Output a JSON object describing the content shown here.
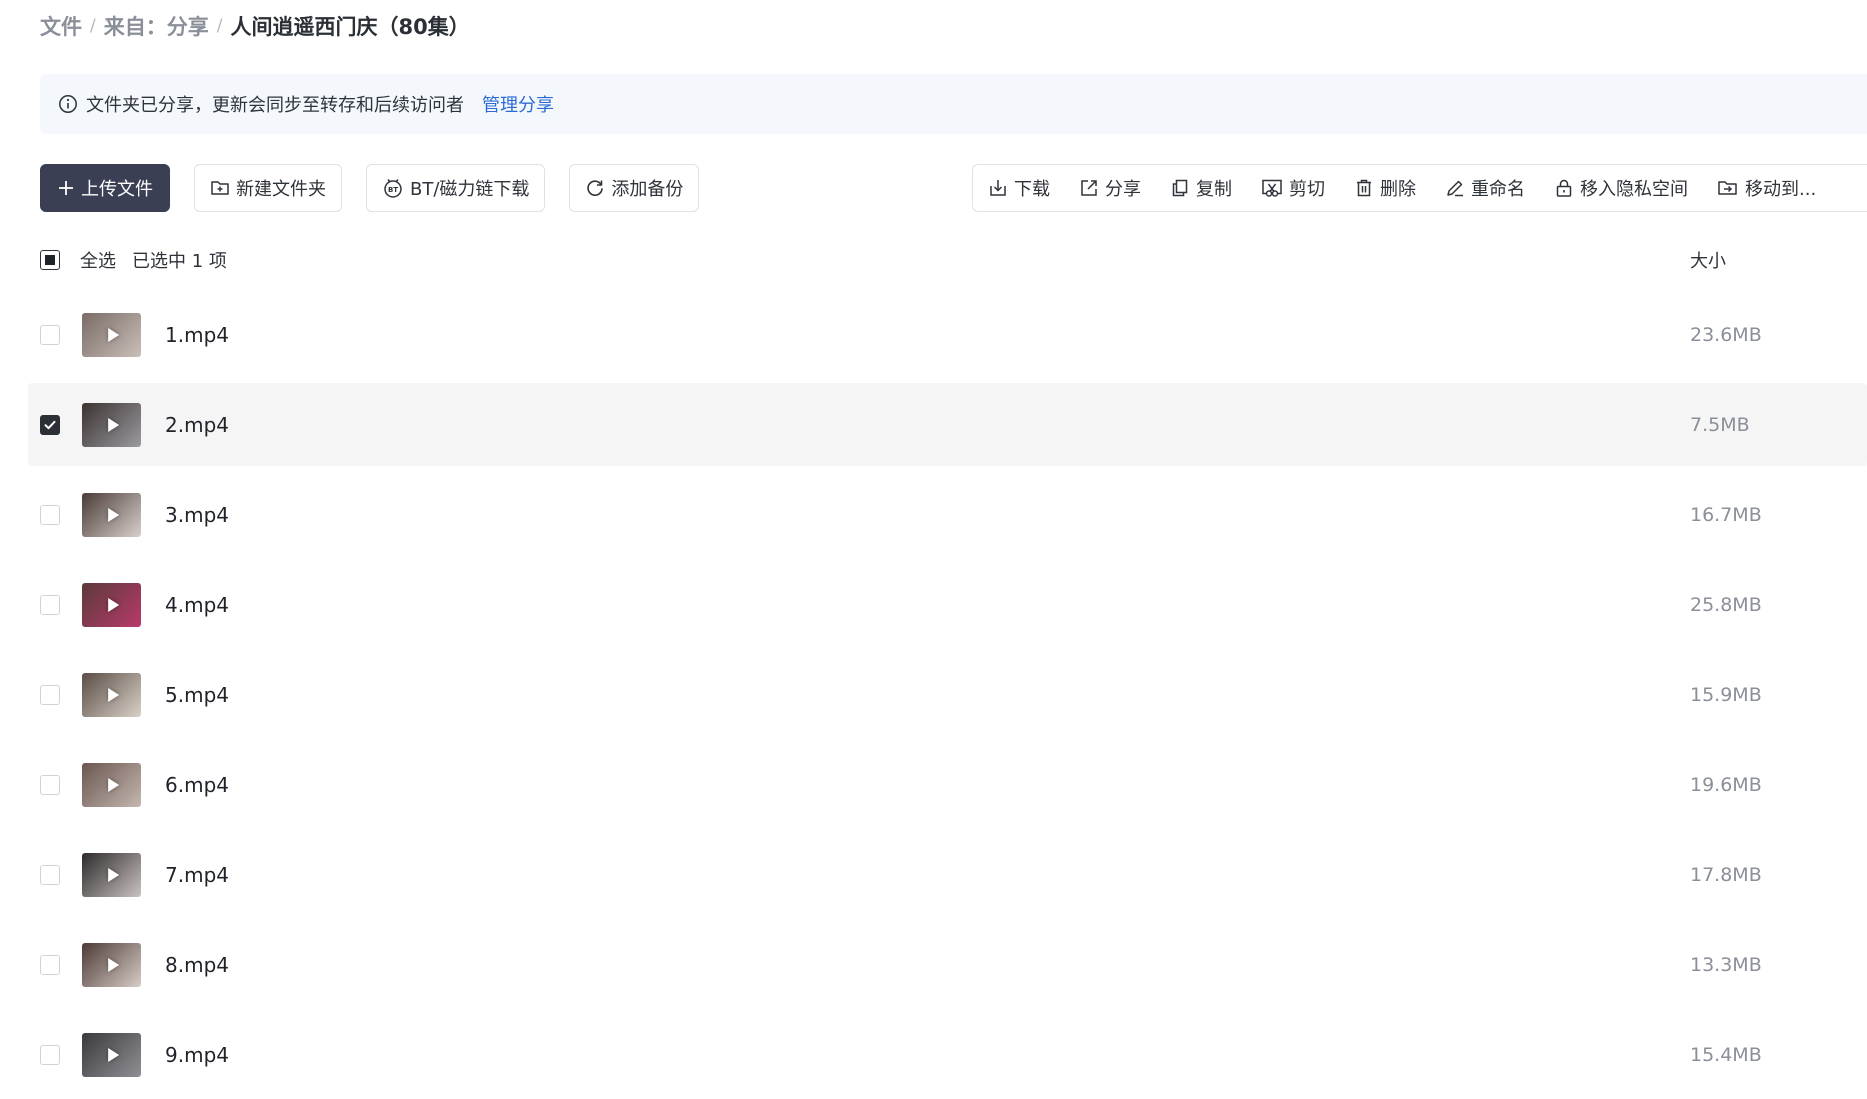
{
  "breadcrumb": {
    "root": "文件",
    "middle": "来自：分享",
    "current": "人间逍遥西门庆（80集）"
  },
  "notice": {
    "text": "文件夹已分享，更新会同步至转存和后续访问者",
    "link": "管理分享"
  },
  "toolbar": {
    "upload": "上传文件",
    "new_folder": "新建文件夹",
    "bt_download": "BT/磁力链下载",
    "add_backup": "添加备份"
  },
  "actions": {
    "download": "下载",
    "share": "分享",
    "copy": "复制",
    "cut": "剪切",
    "delete": "删除",
    "rename": "重命名",
    "private": "移入隐私空间",
    "move": "移动到..."
  },
  "list_header": {
    "select_all": "全选",
    "selected_count": "已选中 1 项",
    "size_column": "大小"
  },
  "files": [
    {
      "name": "1.mp4",
      "size": "23.6MB",
      "selected": false,
      "thumb_colors": [
        "#7a6b66",
        "#c9bfb8"
      ]
    },
    {
      "name": "2.mp4",
      "size": "7.5MB",
      "selected": true,
      "thumb_colors": [
        "#3b3331",
        "#9b9aa0"
      ]
    },
    {
      "name": "3.mp4",
      "size": "16.7MB",
      "selected": false,
      "thumb_colors": [
        "#4a3c38",
        "#d8d0cc"
      ]
    },
    {
      "name": "4.mp4",
      "size": "25.8MB",
      "selected": false,
      "thumb_colors": [
        "#5b3a3a",
        "#b83a6b"
      ]
    },
    {
      "name": "5.mp4",
      "size": "15.9MB",
      "selected": false,
      "thumb_colors": [
        "#5a4e46",
        "#d9d1c8"
      ]
    },
    {
      "name": "6.mp4",
      "size": "19.6MB",
      "selected": false,
      "thumb_colors": [
        "#6a5650",
        "#c4b8b0"
      ]
    },
    {
      "name": "7.mp4",
      "size": "17.8MB",
      "selected": false,
      "thumb_colors": [
        "#2e2a2b",
        "#c9c3c1"
      ]
    },
    {
      "name": "8.mp4",
      "size": "13.3MB",
      "selected": false,
      "thumb_colors": [
        "#4e3a36",
        "#d6ccc6"
      ]
    },
    {
      "name": "9.mp4",
      "size": "15.4MB",
      "selected": false,
      "thumb_colors": [
        "#3a3a3d",
        "#8f8f95"
      ]
    }
  ]
}
